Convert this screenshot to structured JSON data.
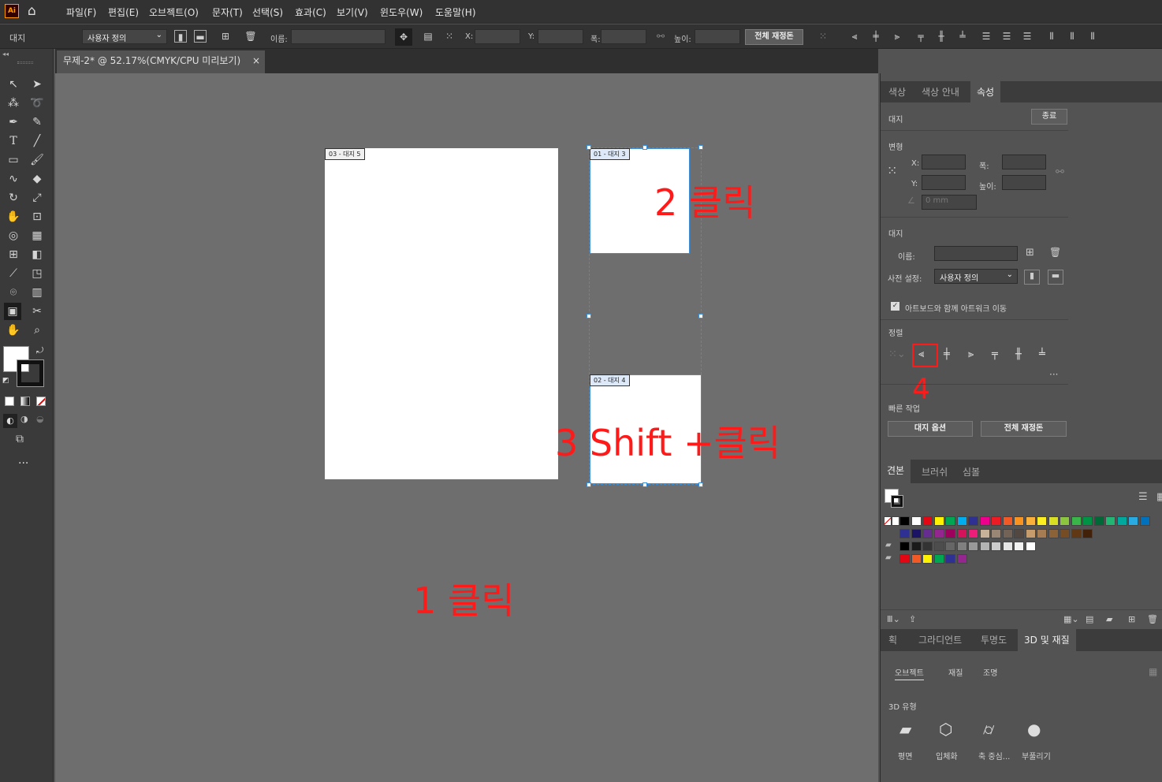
{
  "menubar": {
    "logo": "Ai",
    "items": [
      "파일(F)",
      "편집(E)",
      "오브젝트(O)",
      "문자(T)",
      "선택(S)",
      "효과(C)",
      "보기(V)",
      "윈도우(W)",
      "도움말(H)"
    ]
  },
  "control": {
    "tool_label": "대지",
    "preset": "사용자 정의",
    "name_label": "이름:",
    "x_label": "X:",
    "y_label": "Y:",
    "w_label": "폭:",
    "h_label": "높이:",
    "rearrange_label": "전체 재정돈"
  },
  "document": {
    "tab_title": "무제-2* @ 52.17%(CMYK/CPU 미리보기)",
    "close": "×"
  },
  "artboards": [
    {
      "label": "03 - 대지 5"
    },
    {
      "label": "01 - 대지 3"
    },
    {
      "label": "02 - 대지 4"
    }
  ],
  "annotations": {
    "step1": "1 클릭",
    "step2": "2 클릭",
    "step3": "3 Shift +클릭",
    "step4": "4"
  },
  "panel": {
    "tabs": [
      "색상",
      "색상 안내",
      "속성"
    ],
    "artboard_heading": "대지",
    "exit_label": "종료",
    "transform_heading": "변형",
    "x": "X:",
    "y": "Y:",
    "w": "폭:",
    "h": "높이:",
    "angle": "0 mm",
    "artboard_section": "대지",
    "name_label": "이름:",
    "preset_label": "사전 설정:",
    "preset_value": "사용자 정의",
    "move_artwork": "아트보드와 함께 아트워크 이동",
    "align_heading": "정렬",
    "quick_heading": "빠른 작업",
    "artboard_options": "대지 옵션",
    "rearrange_all": "전체 재정돈",
    "swatch_tabs": [
      "견본",
      "브러쉬",
      "심볼"
    ],
    "bottom_tabs": [
      "획",
      "그라디언트",
      "투명도",
      "3D 및 재질"
    ],
    "sub_tabs": [
      "오브젝트",
      "재질",
      "조명"
    ],
    "type3d_heading": "3D 유형",
    "types": [
      "평면",
      "입체화",
      "축 중심...",
      "부풀리기"
    ]
  },
  "colors": {
    "accent": "#ff1a1a",
    "selection": "#3d8ed9",
    "canvas": "#6e6e6e",
    "swatches": [
      "#000000",
      "#ffffff",
      "#e30613",
      "#fff200",
      "#00a651",
      "#00aeef",
      "#2e3192",
      "#ec008c",
      "#ed1c24",
      "#f15a24",
      "#f7931e",
      "#fbb03b",
      "#fcee21",
      "#d9e021",
      "#8cc63f",
      "#39b54a",
      "#009245",
      "#006837",
      "#22b573",
      "#00a99d",
      "#29abe2",
      "#0071bc",
      "#2e3192",
      "#1b1464",
      "#662d91",
      "#93278f",
      "#9e005d",
      "#d4145a",
      "#ed1e79",
      "#c7b299",
      "#998675",
      "#736357",
      "#534741",
      "#c69c6d",
      "#a67c52",
      "#8c6239",
      "#754c24",
      "#603813",
      "#42210b",
      "#000000",
      "#1a1a1a",
      "#333333",
      "#4d4d4d",
      "#666666",
      "#808080",
      "#999999",
      "#b3b3b3",
      "#cccccc",
      "#e6e6e6",
      "#f2f2f2",
      "#ffffff",
      "#e30613",
      "#f15a24",
      "#fff200",
      "#00a651",
      "#2e3192",
      "#93278f"
    ]
  }
}
